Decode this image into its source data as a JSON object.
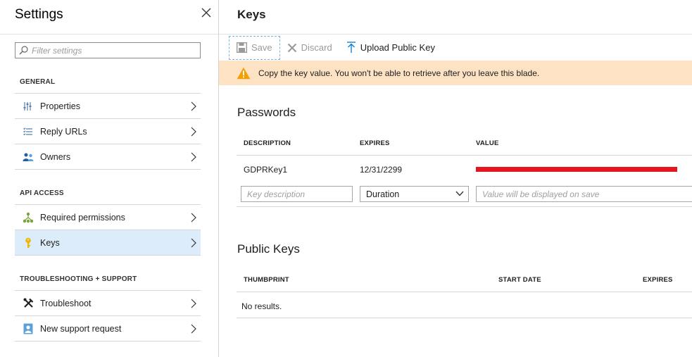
{
  "settings": {
    "title": "Settings",
    "filter_placeholder": "Filter settings",
    "sections": {
      "general": "GENERAL",
      "api_access": "API ACCESS",
      "troubleshooting": "TROUBLESHOOTING + SUPPORT"
    },
    "items": {
      "properties": "Properties",
      "reply_urls": "Reply URLs",
      "owners": "Owners",
      "required_permissions": "Required permissions",
      "keys": "Keys",
      "troubleshoot": "Troubleshoot",
      "new_support_request": "New support request"
    }
  },
  "keys": {
    "title": "Keys",
    "toolbar": {
      "save": "Save",
      "discard": "Discard",
      "upload": "Upload Public Key"
    },
    "warning": "Copy the key value. You won't be able to retrieve after you leave this blade.",
    "passwords": {
      "heading": "Passwords",
      "columns": [
        "DESCRIPTION",
        "EXPIRES",
        "VALUE"
      ],
      "rows": [
        {
          "description": "GDPRKey1",
          "expires": "12/31/2299",
          "value": ""
        }
      ],
      "new_row": {
        "description_placeholder": "Key description",
        "duration_value": "Duration",
        "value_placeholder": "Value will be displayed on save"
      }
    },
    "public_keys": {
      "heading": "Public Keys",
      "columns": [
        "THUMBPRINT",
        "START DATE",
        "EXPIRES"
      ],
      "empty": "No results."
    }
  },
  "colors": {
    "active_item": "#dcecfa",
    "warning_bg": "#fde3c4",
    "warning_icon": "#f2a000",
    "accent_blue": "#0078d4",
    "redaction": "#e4151f"
  }
}
